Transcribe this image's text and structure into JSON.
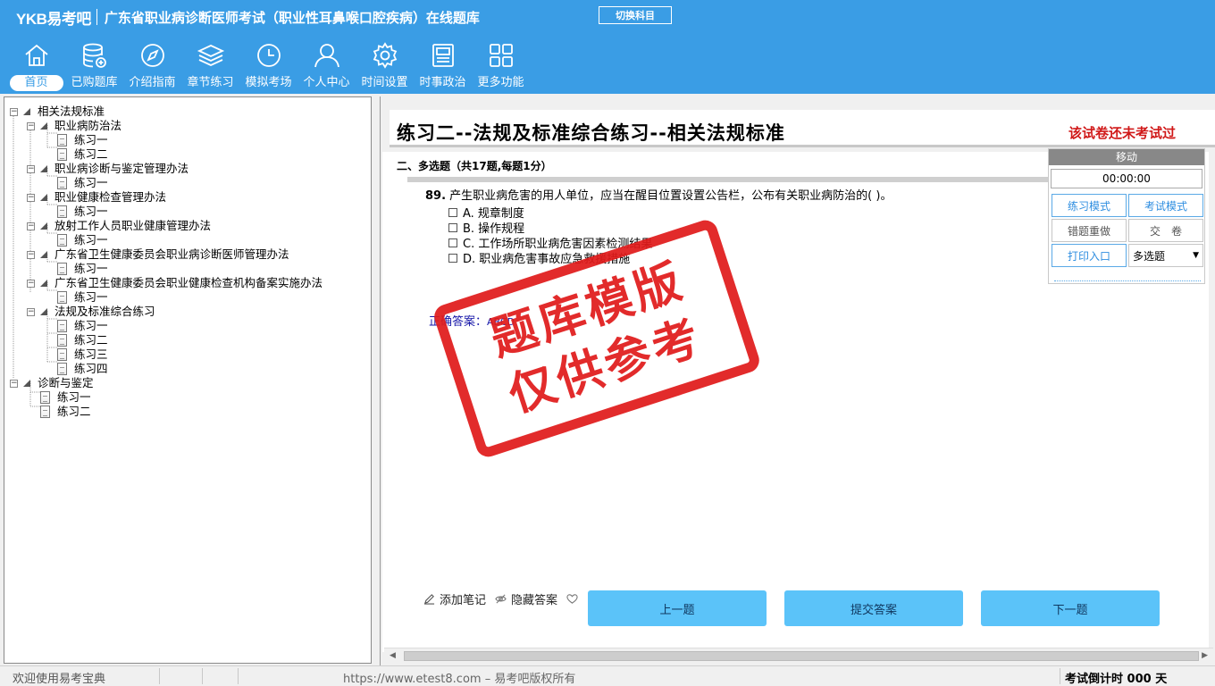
{
  "header": {
    "brand": "YKB易考吧",
    "title": "广东省职业病诊断医师考试（职业性耳鼻喉口腔疾病）在线题库",
    "switch_label": "切换科目"
  },
  "nav": [
    {
      "label": "首页",
      "icon": "home-icon"
    },
    {
      "label": "已购题库",
      "icon": "database-icon"
    },
    {
      "label": "介绍指南",
      "icon": "compass-icon"
    },
    {
      "label": "章节练习",
      "icon": "layers-icon"
    },
    {
      "label": "模拟考场",
      "icon": "clock-icon"
    },
    {
      "label": "个人中心",
      "icon": "user-icon"
    },
    {
      "label": "时间设置",
      "icon": "gear-icon"
    },
    {
      "label": "时事政治",
      "icon": "news-icon"
    },
    {
      "label": "更多功能",
      "icon": "grid-icon"
    }
  ],
  "tree": [
    {
      "label": "相关法规标准",
      "type": "group",
      "level": 0
    },
    {
      "label": "职业病防治法",
      "type": "group",
      "level": 1
    },
    {
      "label": "练习一",
      "type": "leaf",
      "level": 2
    },
    {
      "label": "练习二",
      "type": "leaf",
      "level": 2
    },
    {
      "label": "职业病诊断与鉴定管理办法",
      "type": "group",
      "level": 1
    },
    {
      "label": "练习一",
      "type": "leaf",
      "level": 2
    },
    {
      "label": "职业健康检查管理办法",
      "type": "group",
      "level": 1
    },
    {
      "label": "练习一",
      "type": "leaf",
      "level": 2
    },
    {
      "label": "放射工作人员职业健康管理办法",
      "type": "group",
      "level": 1
    },
    {
      "label": "练习一",
      "type": "leaf",
      "level": 2
    },
    {
      "label": "广东省卫生健康委员会职业病诊断医师管理办法",
      "type": "group",
      "level": 1
    },
    {
      "label": "练习一",
      "type": "leaf",
      "level": 2
    },
    {
      "label": "广东省卫生健康委员会职业健康检查机构备案实施办法",
      "type": "group",
      "level": 1
    },
    {
      "label": "练习一",
      "type": "leaf",
      "level": 2
    },
    {
      "label": "法规及标准综合练习",
      "type": "group",
      "level": 1
    },
    {
      "label": "练习一",
      "type": "leaf",
      "level": 2
    },
    {
      "label": "练习二",
      "type": "leaf",
      "level": 2
    },
    {
      "label": "练习三",
      "type": "leaf",
      "level": 2
    },
    {
      "label": "练习四",
      "type": "leaf",
      "level": 2
    },
    {
      "label": "诊断与鉴定",
      "type": "group",
      "level": 0
    },
    {
      "label": "练习一",
      "type": "leaf",
      "level": 1
    },
    {
      "label": "练习二",
      "type": "leaf",
      "level": 1
    }
  ],
  "paper": {
    "title": "练习二--法规及标准综合练习--相关法规标准",
    "status": "该试卷还未考试过",
    "section": "二、多选题（共17题,每题1分）"
  },
  "question": {
    "number": "89.",
    "text": "产生职业病危害的用人单位，应当在醒目位置设置公告栏，公布有关职业病防治的( )。",
    "options": [
      "A. 规章制度",
      "B. 操作规程",
      "C. 工作场所职业病危害因素检测结果",
      "D. 职业病危害事故应急救援措施"
    ],
    "answer_label": "正确答案：",
    "answer_value": "ABCD"
  },
  "actions": {
    "add_note": "添加笔记",
    "hide_answer": "隐藏答案",
    "prev": "上一题",
    "submit": "提交答案",
    "next": "下一题"
  },
  "floating_panel": {
    "header": "移动",
    "timer": "00:00:00",
    "practice_mode": "练习模式",
    "exam_mode": "考试模式",
    "redo_wrong": "错题重做",
    "hand_in": "交　卷",
    "print": "打印入口",
    "type_select": "多选题"
  },
  "stamp": {
    "line1": "题库模版",
    "line2": "仅供参考"
  },
  "status_bar": {
    "welcome": "欢迎使用易考宝典",
    "url": "https://www.etest8.com – 易考吧版权所有",
    "countdown": "考试倒计时 000 天"
  },
  "colors": {
    "header_bg": "#3a9de5",
    "button_bg": "#5bc3f9",
    "alert_red": "#d01818",
    "answer_blue": "#1616a8"
  }
}
